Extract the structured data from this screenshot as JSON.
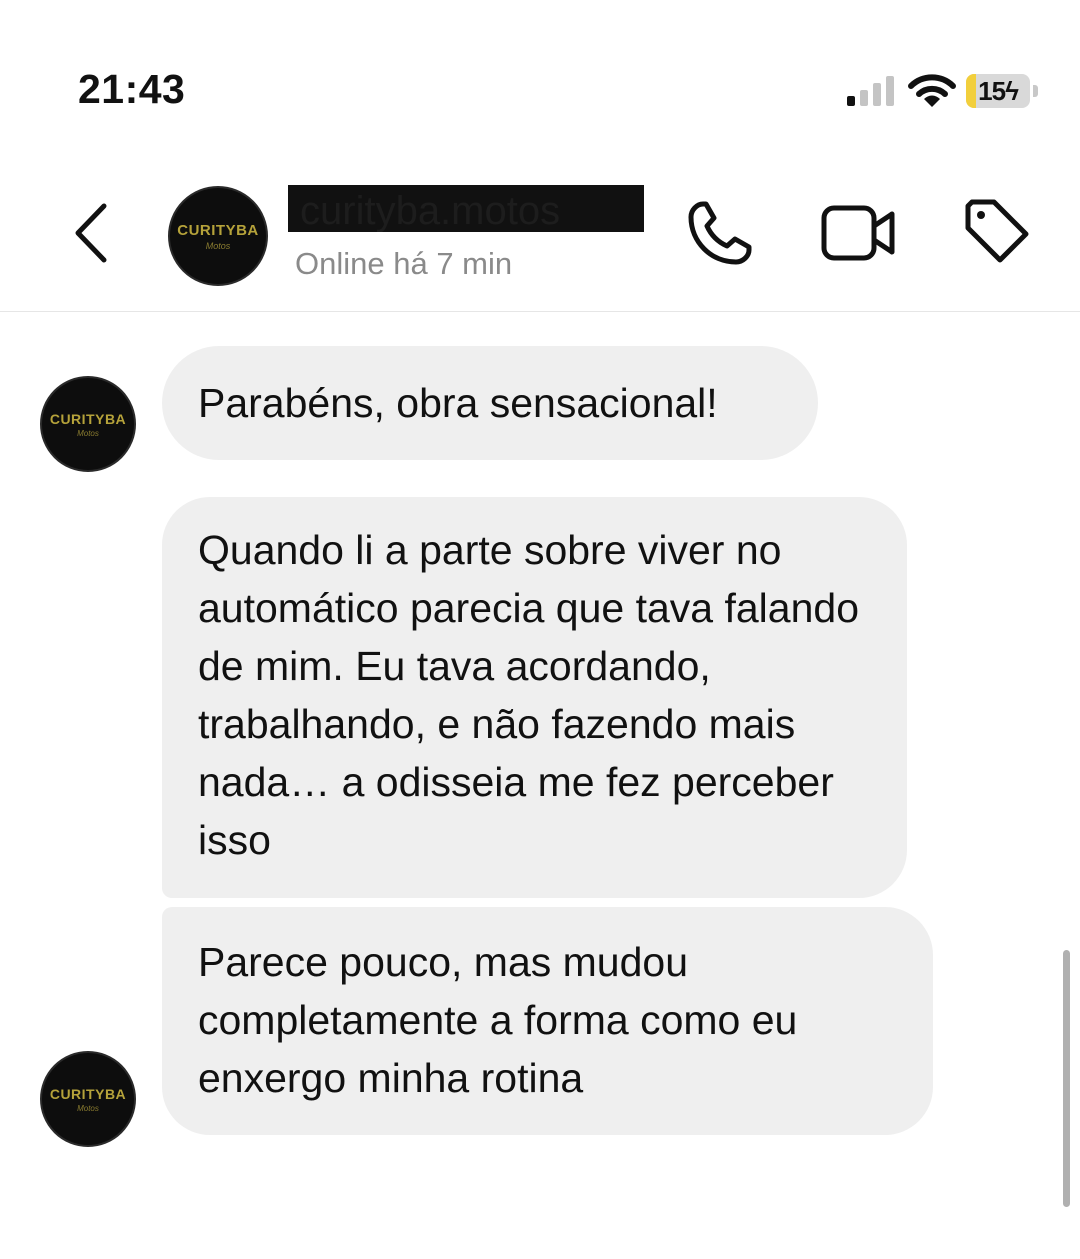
{
  "status_bar": {
    "time": "21:43",
    "battery_level": "15",
    "battery_charging": true,
    "signal_bars_active": 1,
    "signal_bars_total": 4
  },
  "header": {
    "username": "curityba.motos",
    "status": "Online há 7 min",
    "avatar_logo": "CURITYBA",
    "avatar_logo_sub": "Motos",
    "icons": [
      "back-icon",
      "phone-icon",
      "video-icon",
      "tag-icon"
    ]
  },
  "messages": [
    {
      "text": "Parabéns, obra sensacional!"
    },
    {
      "text": "Quando li a parte sobre viver no automático parecia que tava falando de mim. Eu tava acordando, trabalhando, e não fazendo mais nada… a odisseia me fez perceber isso"
    },
    {
      "text": "Parece pouco, mas mudou completamente a forma como eu enxergo minha rotina"
    }
  ],
  "colors": {
    "bubble": "#efefef",
    "battery_charging": "#f2cf3c",
    "secondary_text": "#8a8a8a",
    "logo_gold": "#b5a23a"
  }
}
